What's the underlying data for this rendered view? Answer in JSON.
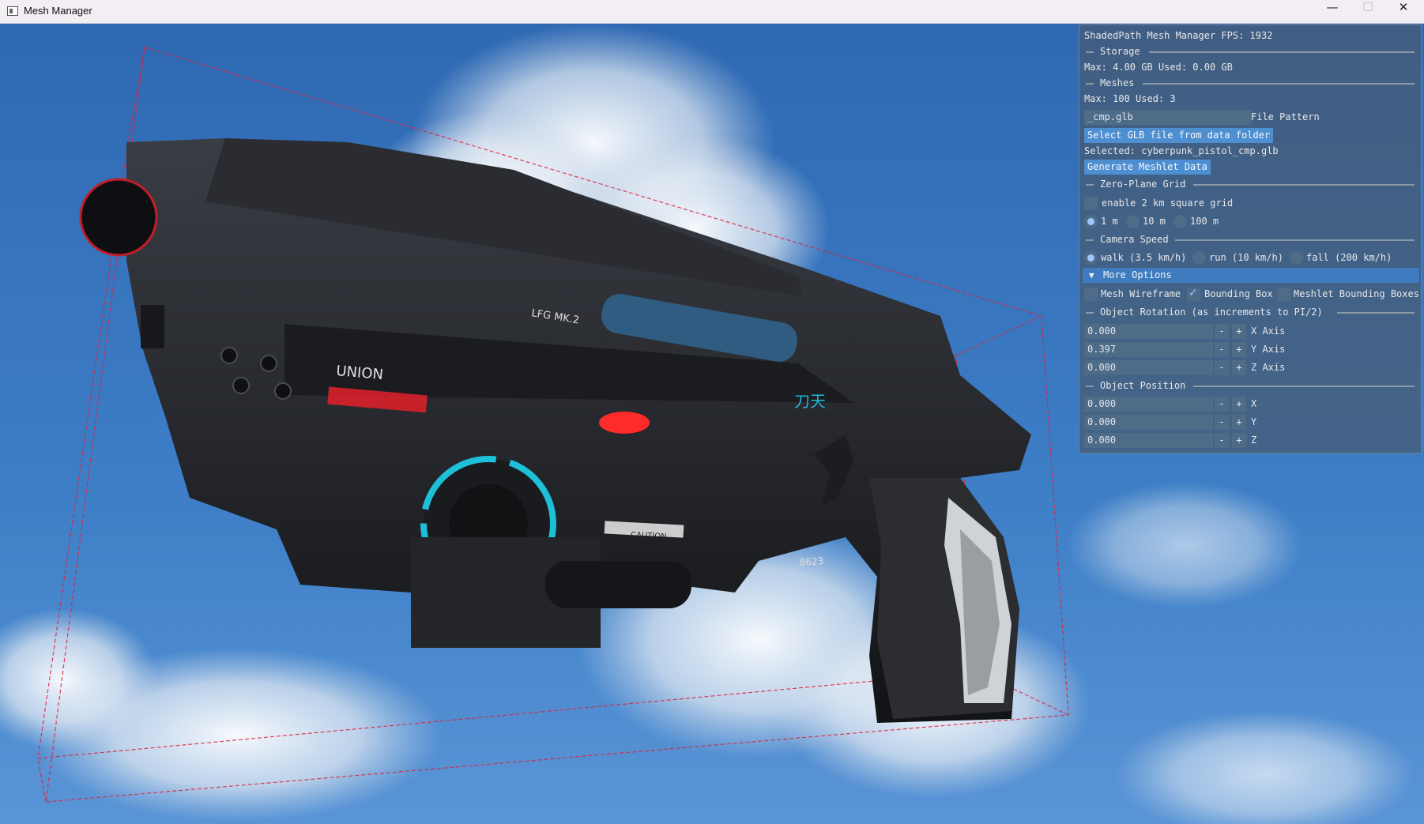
{
  "window": {
    "title": "Mesh Manager",
    "minimize": "—",
    "maximize": "☐",
    "close": "✕"
  },
  "scene": {
    "labels": {
      "union": "UNION",
      "model": "LFG MK.2",
      "caution": "CAUTION",
      "serial": "8623",
      "glyph": "刀天"
    }
  },
  "panel": {
    "header": "ShadedPath Mesh Manager FPS: 1932",
    "storage": {
      "title": "Storage",
      "info": "Max: 4.00 GB Used: 0.00 GB"
    },
    "meshes": {
      "title": "Meshes",
      "info": "Max: 100 Used: 3"
    },
    "file_pattern": {
      "value": "_cmp.glb",
      "label": "File Pattern"
    },
    "select_button": "Select GLB file from data folder",
    "selected": "Selected: cyberpunk_pistol_cmp.glb",
    "generate_button": "Generate Meshlet Data",
    "grid": {
      "title": "Zero-Plane Grid",
      "enable_label": "enable 2 km square grid",
      "enabled": false,
      "options": [
        "1 m",
        "10 m",
        "100 m"
      ],
      "selected": "1 m"
    },
    "camera": {
      "title": "Camera Speed",
      "options": [
        "walk (3.5 km/h)",
        "run (10 km/h)",
        "fall (200 km/h)"
      ],
      "selected": "walk (3.5 km/h)"
    },
    "more_options": {
      "label": "More Options",
      "wireframe": {
        "label": "Mesh Wireframe",
        "checked": false
      },
      "bbox": {
        "label": "Bounding Box",
        "checked": true
      },
      "meshlet_bbox": {
        "label": "Meshlet Bounding Boxes",
        "checked": false
      }
    },
    "rotation": {
      "title": "Object Rotation (as increments to PI/2)",
      "x": {
        "value": "0.000",
        "label": "X Axis"
      },
      "y": {
        "value": "0.397",
        "label": "Y Axis"
      },
      "z": {
        "value": "0.000",
        "label": "Z Axis"
      }
    },
    "position": {
      "title": "Object Position",
      "x": {
        "value": "0.000",
        "label": "X"
      },
      "y": {
        "value": "0.000",
        "label": "Y"
      },
      "z": {
        "value": "0.000",
        "label": "Z"
      }
    },
    "minus": "-",
    "plus": "+"
  }
}
